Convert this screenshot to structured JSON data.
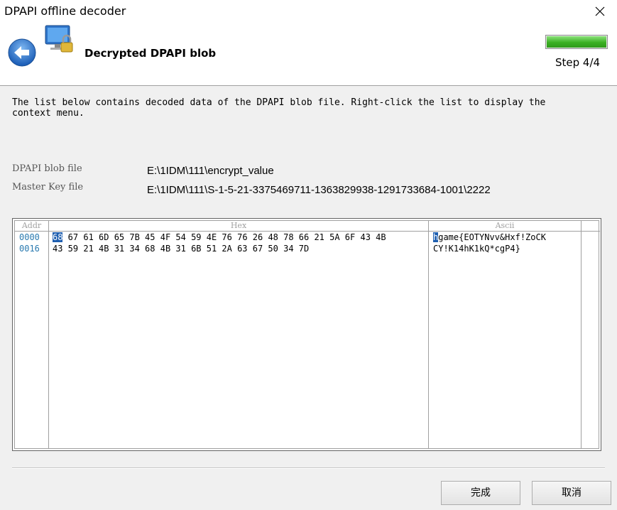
{
  "window": {
    "title": "DPAPI offline decoder"
  },
  "header": {
    "title": "Decrypted DPAPI blob",
    "step": "Step 4/4",
    "progress_fraction": 1.0
  },
  "description": "The list below contains decoded data of the DPAPI blob file. Right-click the list to display the\ncontext menu.",
  "fields": {
    "blob_label": "DPAPI blob file",
    "blob_value": "E:\\1IDM\\111\\encrypt_value",
    "masterkey_label": "Master Key file",
    "masterkey_value": "E:\\1IDM\\111\\S-1-5-21-3375469711-1363829938-1291733684-1001\\2222"
  },
  "hexview": {
    "headers": {
      "addr": "Addr",
      "hex": "Hex",
      "ascii": "Ascii"
    },
    "rows": [
      {
        "addr": "0000",
        "hex_first": "68",
        "hex_rest": " 67 61 6D 65 7B 45 4F 54 59 4E 76 76 26 48 78 66 21 5A 6F 43 4B",
        "ascii_first": "h",
        "ascii_rest": "game{EOTYNvv&Hxf!ZoCK"
      },
      {
        "addr": "0016",
        "hex_first": "",
        "hex_rest": "43 59 21 4B 31 34 68 4B 31 6B 51 2A 63 67 50 34 7D",
        "ascii_first": "",
        "ascii_rest": "CY!K14hK1kQ*cgP4}"
      }
    ]
  },
  "buttons": {
    "finish": "完成",
    "cancel": "取消"
  },
  "colors": {
    "selection": "#1f5fb0",
    "address": "#2a7ab0",
    "progress": "#3bb023"
  }
}
